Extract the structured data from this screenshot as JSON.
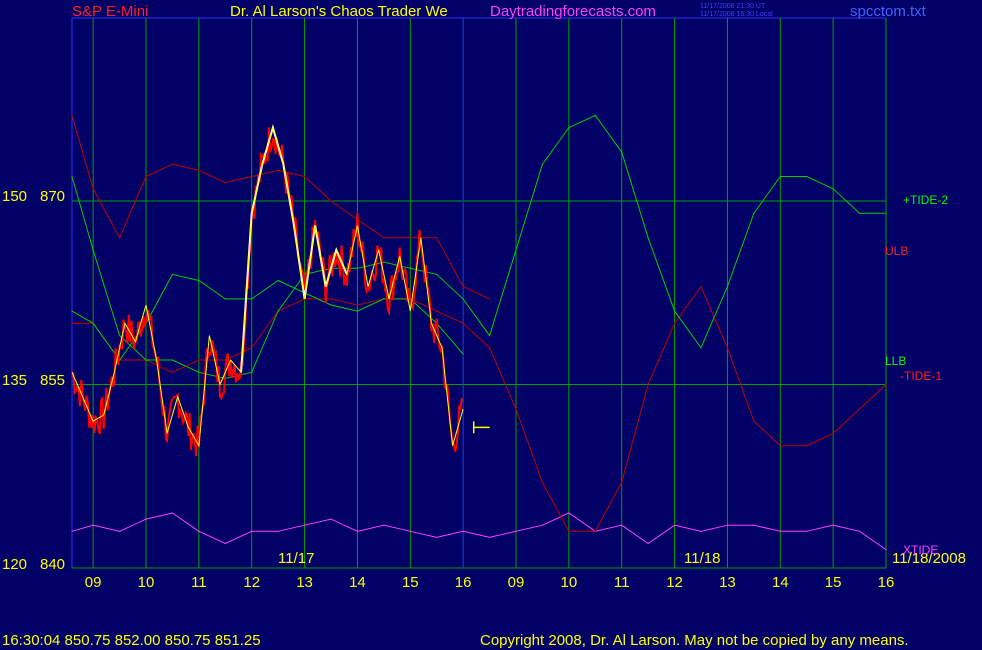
{
  "header": {
    "instrument": "S&P E-Mini",
    "title": "Dr. Al Larson's Chaos Trader We",
    "site": "Daytradingforecasts.com",
    "timestamp_ut": "11/17/2008 21:30 UT",
    "timestamp_local": "11/17/2008 16:30 Local",
    "filename": "spcctom.txt"
  },
  "footer": {
    "quote": "16:30:04  850.75  852.00  850.75  851.25",
    "copyright": "Copyright 2008, Dr. Al Larson. May not be copied by any means."
  },
  "colors": {
    "background": "#000066",
    "grid": "#00a000",
    "price_red": "#ff0000",
    "price_white": "#ffffff",
    "yellow": "#ffff00",
    "blue": "#2020ff",
    "green": "#00d000",
    "magenta": "#ff40ff",
    "dark_red": "#c00000"
  },
  "chart_data": {
    "type": "line",
    "y_left_labels": [
      {
        "osc": "150",
        "price": "870"
      },
      {
        "osc": "135",
        "price": "855"
      },
      {
        "osc": "120",
        "price": "840"
      }
    ],
    "x_ticks": [
      "09",
      "10",
      "11",
      "12",
      "13",
      "14",
      "15",
      "16",
      "09",
      "10",
      "11",
      "12",
      "13",
      "14",
      "15",
      "16"
    ],
    "date_labels": [
      "11/17",
      "11/18",
      "11/18/2008"
    ],
    "series_labels": [
      {
        "name": "+TIDE-2",
        "color": "#00ff00"
      },
      {
        "name": "ULB",
        "color": "#ff2020"
      },
      {
        "name": "LLB",
        "color": "#00ff00"
      },
      {
        "name": "-TIDE-1",
        "color": "#ff2020"
      },
      {
        "name": "XTIDE",
        "color": "#ff40ff"
      }
    ],
    "price_ylim": [
      840,
      870
    ],
    "series": [
      {
        "name": "+TIDE-2",
        "x": [
          8.6,
          9.0,
          9.5,
          10.0,
          10.5,
          11.0,
          11.5,
          12.0,
          12.5,
          13.0,
          13.5,
          14.0,
          14.5,
          15.0,
          15.5,
          16.0,
          16.5,
          17.0,
          17.5,
          18.0,
          18.5,
          19.0,
          19.5,
          20.0,
          20.5,
          21.0,
          21.5,
          22.0,
          22.5,
          23.0,
          23.5,
          24.0
        ],
        "y": [
          872,
          866,
          859,
          857,
          857,
          856,
          855.5,
          856,
          861,
          864,
          864.5,
          864.5,
          865,
          864.5,
          864,
          862,
          859,
          866,
          873,
          876,
          877,
          874,
          867,
          861,
          858,
          863,
          869,
          872,
          872,
          871,
          869,
          869
        ]
      },
      {
        "name": "-TIDE-1",
        "x": [
          8.6,
          9.0,
          9.5,
          10.0,
          10.5,
          11.0,
          11.5,
          12.0,
          12.5,
          13.0,
          13.5,
          14.0,
          14.5,
          15.0,
          15.5,
          16.0,
          16.5,
          17.0,
          17.5,
          18.0,
          18.5,
          19.0,
          19.5,
          20.0,
          20.5,
          21.0,
          21.5,
          22.0,
          22.5,
          23.0,
          23.5,
          24.0
        ],
        "y": [
          860,
          860,
          857,
          857,
          856,
          857,
          857,
          858,
          861,
          862,
          862,
          861.5,
          862,
          862,
          861,
          860,
          858,
          853,
          847,
          843,
          843,
          847,
          855,
          860,
          863,
          858,
          852,
          850,
          850,
          851,
          853,
          855
        ]
      },
      {
        "name": "ULB",
        "x": [
          8.6,
          9.0,
          9.5,
          10.0,
          10.5,
          11.0,
          11.5,
          12.0,
          12.5,
          13.0,
          13.5,
          14.0,
          14.5,
          15.0,
          15.5,
          16.0,
          16.5
        ],
        "y": [
          877,
          871,
          867,
          872,
          873,
          872.5,
          871.5,
          872,
          872.5,
          872,
          870,
          868.5,
          867,
          867,
          867,
          863,
          862
        ]
      },
      {
        "name": "LLB",
        "x": [
          8.6,
          9.0,
          9.5,
          10.0,
          10.5,
          11.0,
          11.5,
          12.0,
          12.5,
          13.0,
          13.5,
          14.0,
          14.5,
          15.0,
          15.5,
          16.0
        ],
        "y": [
          861,
          860,
          857,
          860,
          864,
          863.5,
          862,
          862,
          863.5,
          862.5,
          861.5,
          861,
          862,
          862,
          860,
          857.5
        ]
      },
      {
        "name": "XTIDE",
        "x": [
          8.6,
          9.0,
          9.5,
          10.0,
          10.5,
          11.0,
          11.5,
          12.0,
          12.5,
          13.0,
          13.5,
          14.0,
          14.5,
          15.0,
          15.5,
          16.0,
          16.5,
          17.0,
          17.5,
          18.0,
          18.5,
          19.0,
          19.5,
          20.0,
          20.5,
          21.0,
          21.5,
          22.0,
          22.5,
          23.0,
          23.5,
          24.0
        ],
        "y": [
          843,
          843.5,
          843,
          844,
          844.5,
          843,
          842,
          843,
          843,
          843.5,
          844,
          843,
          843.5,
          843,
          842.5,
          843,
          842.5,
          843,
          843.5,
          844.5,
          843,
          843.5,
          842,
          843.5,
          843,
          843.5,
          843.5,
          843,
          843,
          843.5,
          843,
          841.5
        ]
      },
      {
        "name": "price",
        "x": [
          8.6,
          8.8,
          9.0,
          9.2,
          9.4,
          9.6,
          9.8,
          10.0,
          10.2,
          10.4,
          10.6,
          10.8,
          11.0,
          11.2,
          11.4,
          11.6,
          11.8,
          12.0,
          12.2,
          12.4,
          12.6,
          12.8,
          13.0,
          13.2,
          13.4,
          13.6,
          13.8,
          14.0,
          14.2,
          14.4,
          14.6,
          14.8,
          15.0,
          15.2,
          15.4,
          15.6,
          15.8,
          16.0
        ],
        "y": [
          856,
          854,
          852,
          852.5,
          856,
          860,
          858.5,
          861.5,
          857,
          851,
          854,
          851.5,
          850,
          859,
          855,
          857,
          856,
          869,
          873,
          876,
          873,
          868,
          862,
          868,
          863,
          866,
          864,
          868,
          863,
          866,
          862,
          865.5,
          861,
          867,
          860,
          858,
          850,
          853
        ]
      }
    ]
  }
}
